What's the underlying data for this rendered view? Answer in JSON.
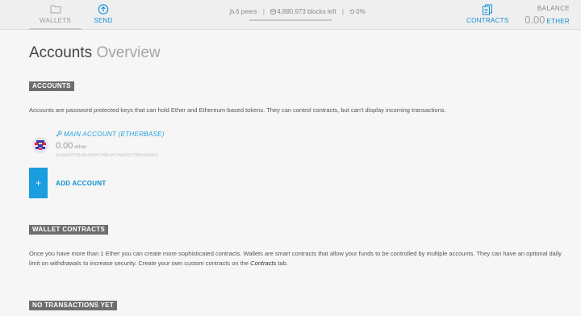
{
  "header": {
    "nav": {
      "wallets": "WALLETS",
      "send": "SEND",
      "contracts": "CONTRACTS"
    },
    "status": {
      "peers": "6 peers",
      "blocks": "4,880,973 blocks left",
      "progress": "0%"
    },
    "balance": {
      "label": "BALANCE",
      "amount": "0.00",
      "unit": "ETHER"
    }
  },
  "main": {
    "title": "Accounts",
    "title_suffix": "Overview",
    "accounts_section": {
      "tag": "ACCOUNTS",
      "description": "Accounts are password protected keys that can hold Ether and Ethereum-based tokens. They can control contracts, but can't display incoming transactions.",
      "accounts": [
        {
          "name": "MAIN ACCOUNT (ETHERBASE)",
          "balance": "0.00",
          "unit": "ether",
          "address": "0xdda0767849e3B45C49EcBC4dA3917B8c50a80S"
        }
      ],
      "add_account": {
        "icon": "+",
        "label": "ADD ACCOUNT"
      }
    },
    "contracts_section": {
      "tag": "WALLET CONTRACTS",
      "description_before": "Once you have more than 1 Ether you can create more sophisticated contracts. Wallets are smart contracts that allow your funds to be controlled by multiple accounts. They can have an optional daily limit on withdrawals to increase security. Create your own custom contracts on the ",
      "description_link": "Contracts",
      "description_after": " tab."
    },
    "transactions_section": {
      "tag": "NO TRANSACTIONS YET"
    }
  },
  "colors": {
    "accent": "#0c8ed2",
    "tag_bg": "#6e6e6e",
    "add_button": "#1a9ee0",
    "background": "#f6f6f6"
  }
}
